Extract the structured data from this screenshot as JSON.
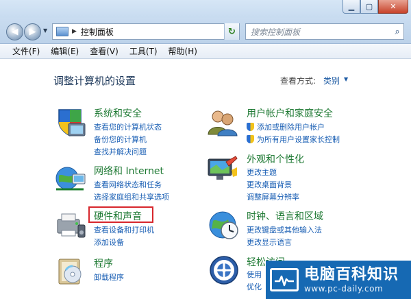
{
  "window": {
    "caption_buttons": [
      {
        "name": "minimize",
        "glyph": "▁"
      },
      {
        "name": "maximize",
        "glyph": "▢"
      },
      {
        "name": "close",
        "glyph": "✕"
      }
    ]
  },
  "navbar": {
    "back_glyph": "◀",
    "forward_glyph": "▶",
    "dropdown_glyph": "▼",
    "address_separator": "▶",
    "address_text": "控制面板",
    "refresh_glyph": "↻",
    "search_placeholder": "搜索控制面板",
    "search_glyph": "⌕"
  },
  "menubar": {
    "items": [
      "文件(F)",
      "编辑(E)",
      "查看(V)",
      "工具(T)",
      "帮助(H)"
    ]
  },
  "content": {
    "title": "调整计算机的设置",
    "view_by_label": "查看方式:",
    "view_by_value": "类别",
    "view_by_arrow": "▼"
  },
  "categories": {
    "system": {
      "title": "系统和安全",
      "links": [
        "查看您的计算机状态",
        "备份您的计算机",
        "查找并解决问题"
      ]
    },
    "network": {
      "title": "网络和 Internet",
      "links": [
        "查看网络状态和任务",
        "选择家庭组和共享选项"
      ]
    },
    "hardware": {
      "title": "硬件和声音",
      "links": [
        "查看设备和打印机",
        "添加设备"
      ]
    },
    "programs": {
      "title": "程序",
      "links": [
        "卸载程序"
      ]
    },
    "users": {
      "title": "用户帐户和家庭安全",
      "links": [
        "添加或删除用户帐户",
        "为所有用户设置家长控制"
      ]
    },
    "appearance": {
      "title": "外观和个性化",
      "links": [
        "更改主题",
        "更改桌面背景",
        "调整屏幕分辨率"
      ]
    },
    "clock": {
      "title": "时钟、语言和区域",
      "links": [
        "更改键盘或其他输入法",
        "更改显示语言"
      ]
    },
    "ease": {
      "title": "轻松访问",
      "links": [
        "使用",
        "优化"
      ]
    }
  },
  "watermark": {
    "title": "电脑百科知识",
    "url": "www.pc-daily.com"
  }
}
